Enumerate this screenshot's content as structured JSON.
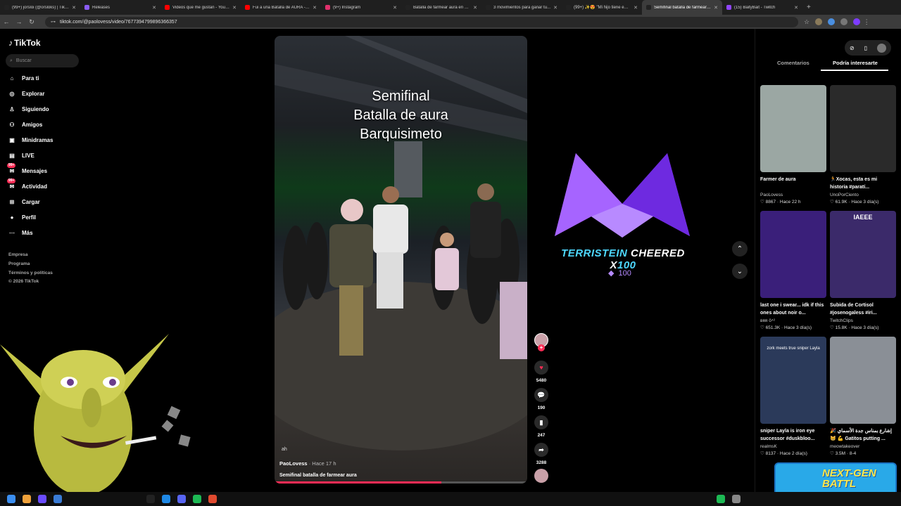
{
  "tabs": [
    {
      "title": "(99+) jorsloi (@orsloks) | TikTok",
      "color": "#222222"
    },
    {
      "title": "Releases",
      "color": "#8a5cf6"
    },
    {
      "title": "Videos que me gustan - YouTube",
      "color": "#ff0000"
    },
    {
      "title": "Fui a una Batalla de AURA - YouTube",
      "color": "#ff0000"
    },
    {
      "title": "(9+) Instagram",
      "color": "#e1306c"
    },
    {
      "title": "Batalla de farmear aura en Un...",
      "color": "#222222"
    },
    {
      "title": "3 movimientos para ganar tu...",
      "color": "#222222"
    },
    {
      "title": "(99+) ✨😍 \"Mi hijo tiene em...",
      "color": "#222222"
    },
    {
      "title": "Semifinal batalla de farmear a...",
      "color": "#222222",
      "active": true
    },
    {
      "title": "(15) BaityBait - Twitch",
      "color": "#9146ff"
    }
  ],
  "browser": {
    "url": "tiktok.com/@paolovess/video/7677394799896366357"
  },
  "sidebar": {
    "logo": "TikTok",
    "search_placeholder": "Buscar",
    "items": [
      {
        "label": "Para ti",
        "icon": "home-icon"
      },
      {
        "label": "Explorar",
        "icon": "compass-icon"
      },
      {
        "label": "Siguiendo",
        "icon": "following-icon"
      },
      {
        "label": "Amigos",
        "icon": "friends-icon"
      },
      {
        "label": "Minidramas",
        "icon": "minidramas-icon"
      },
      {
        "label": "LIVE",
        "icon": "live-icon"
      },
      {
        "label": "Mensajes",
        "icon": "messages-icon",
        "badge": "99+"
      },
      {
        "label": "Actividad",
        "icon": "activity-icon",
        "badge": "99+"
      },
      {
        "label": "Cargar",
        "icon": "upload-icon"
      },
      {
        "label": "Perfil",
        "icon": "profile-icon"
      },
      {
        "label": "Más",
        "icon": "more-icon"
      }
    ],
    "footer": [
      "Empresa",
      "Programa",
      "Términos y políticas",
      "© 2026 TikTok"
    ]
  },
  "video": {
    "title_lines": [
      "Semifinal",
      "Batalla de aura",
      "Barquisimeto"
    ],
    "overlay_text": "ah",
    "author": "PaoLovess",
    "time": "Hace 17 h",
    "caption": "Semifinal batalla de farmear aura",
    "progress": 0.66
  },
  "actions": {
    "likes": "5480",
    "comments": "190",
    "saves": "247",
    "shares": "3288"
  },
  "cheer": {
    "name": "TERRISTEIN",
    "text": "CHEERED X",
    "amount_text": "100",
    "bits": "100"
  },
  "right_panel": {
    "tabs": [
      "Comentarios",
      "Podría interesarte"
    ],
    "cards": [
      {
        "title": "Farmer de aura",
        "author": "PaoLovess",
        "likes": "8867",
        "time": "Hace 22 h",
        "thumb": "#9ba7a3"
      },
      {
        "title": "🏃Xocas, esta es mi historia #paratí...",
        "author": "UnoPorCiento",
        "likes": "61.9K",
        "time": "Hace 3 día(s)",
        "thumb": "#2a2a2a"
      },
      {
        "title": "last one i swear... idk if this ones about noir o...",
        "author": "ʙʀʀ ö⁴²",
        "likes": "651.3K",
        "time": "Hace 3 día(s)",
        "thumb": "#3a1f7a"
      },
      {
        "title": "Subida de Cortisol #josenogaless #iri...",
        "author": "TwitchClips",
        "likes": "15.8K",
        "time": "Hace 3 día(s)",
        "thumb": "#3b2a6a"
      },
      {
        "title": "sniper Layla is iron eye successor #duskbloo...",
        "author": "realmsK",
        "likes": "8137",
        "time": "Hace 2 día(s)",
        "thumb": "#2b3a5a"
      },
      {
        "title": "🎉 إشارع بمناس جدة الأسماي 😸 💪 Gatitos putting ...",
        "author": "meowtakeover",
        "likes": "3.5M",
        "time": "8-4",
        "thumb": "#8a8f96"
      }
    ],
    "thumb_text_1": "IAEEE",
    "thumb_text_2": "zork meets true sniper Layla"
  },
  "nextgen_banner": "NEXT-GEN BATTL"
}
